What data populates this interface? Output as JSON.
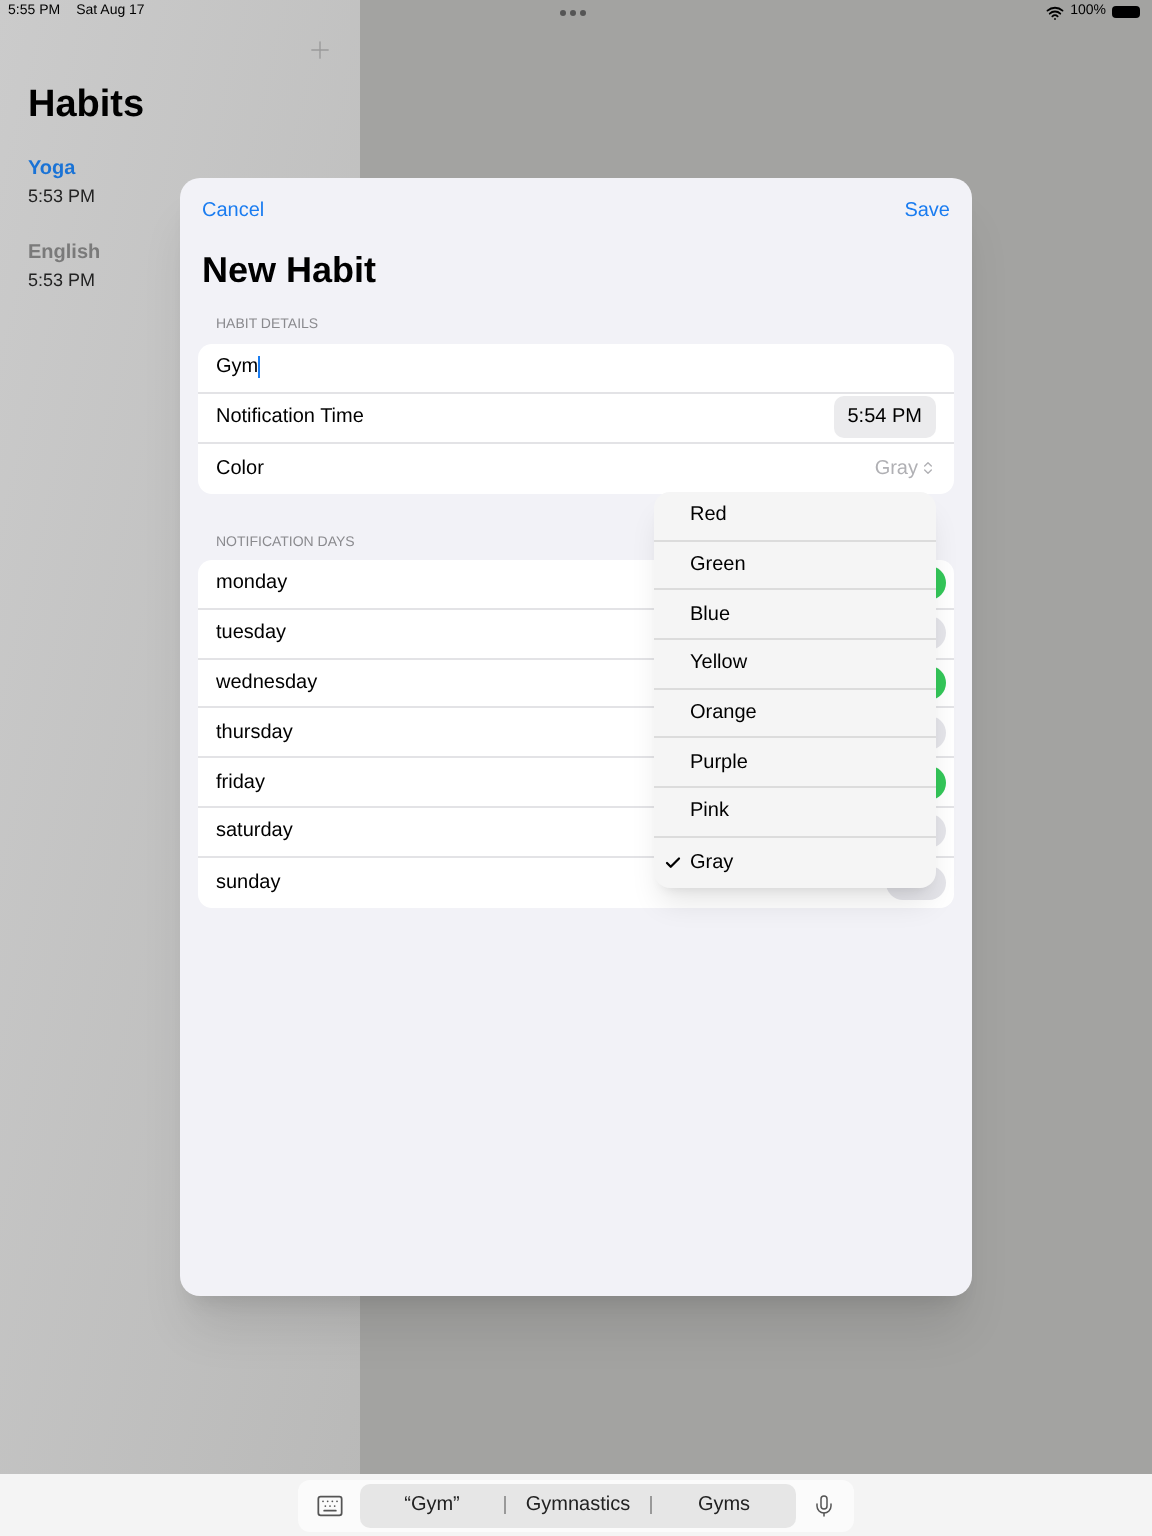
{
  "status_bar": {
    "time": "5:55 PM",
    "date": "Sat Aug 17",
    "battery": "100%"
  },
  "sidebar": {
    "title": "Habits",
    "items": [
      {
        "name": "Yoga",
        "time": "5:53 PM",
        "selected": true
      },
      {
        "name": "English",
        "time": "5:53 PM",
        "selected": false
      }
    ]
  },
  "sheet": {
    "cancel": "Cancel",
    "save": "Save",
    "title": "New Habit",
    "details_header": "HABIT DETAILS",
    "name_value": "Gym",
    "time_label": "Notification Time",
    "time_value": "5:54 PM",
    "color_label": "Color",
    "color_value": "Gray",
    "days_header": "NOTIFICATION DAYS",
    "days": [
      {
        "name": "monday",
        "on": true
      },
      {
        "name": "tuesday",
        "on": false
      },
      {
        "name": "wednesday",
        "on": true
      },
      {
        "name": "thursday",
        "on": false
      },
      {
        "name": "friday",
        "on": true
      },
      {
        "name": "saturday",
        "on": false
      },
      {
        "name": "sunday",
        "on": false
      }
    ]
  },
  "color_menu": {
    "options": [
      {
        "label": "Red",
        "selected": false
      },
      {
        "label": "Green",
        "selected": false
      },
      {
        "label": "Blue",
        "selected": false
      },
      {
        "label": "Yellow",
        "selected": false
      },
      {
        "label": "Orange",
        "selected": false
      },
      {
        "label": "Purple",
        "selected": false
      },
      {
        "label": "Pink",
        "selected": false
      },
      {
        "label": "Gray",
        "selected": true
      }
    ]
  },
  "keyboard_bar": {
    "suggestions": [
      "“Gym”",
      "Gymnastics",
      "Gyms"
    ]
  }
}
